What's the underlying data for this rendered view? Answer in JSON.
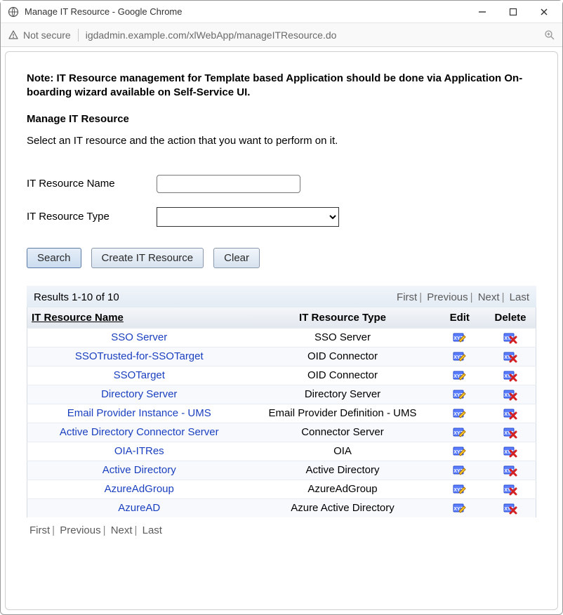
{
  "window": {
    "title": "Manage IT Resource - Google Chrome",
    "security_label": "Not secure",
    "url": "igdadmin.example.com/xlWebApp/manageITResource.do"
  },
  "note": "Note: IT Resource management for Template based Application should be done via Application On-boarding wizard available on Self-Service UI.",
  "heading": "Manage IT Resource",
  "instruction": "Select an IT resource and the action that you want to perform on it.",
  "form": {
    "name_label": "IT Resource Name",
    "type_label": "IT Resource Type",
    "name_value": "",
    "type_value": ""
  },
  "buttons": {
    "search": "Search",
    "create": "Create IT Resource",
    "clear": "Clear"
  },
  "results_label": "Results 1-10 of 10",
  "pager": {
    "first": "First",
    "previous": "Previous",
    "next": "Next",
    "last": "Last"
  },
  "columns": {
    "name": "IT Resource Name ",
    "type": "IT Resource Type",
    "edit": "Edit",
    "delete": "Delete"
  },
  "rows": [
    {
      "name": "SSO Server",
      "type": "SSO Server"
    },
    {
      "name": "SSOTrusted-for-SSOTarget",
      "type": "OID Connector"
    },
    {
      "name": "SSOTarget",
      "type": "OID Connector"
    },
    {
      "name": "Directory Server",
      "type": "Directory Server"
    },
    {
      "name": "Email Provider Instance - UMS",
      "type": "Email Provider Definition - UMS"
    },
    {
      "name": "Active Directory Connector Server",
      "type": "Connector Server"
    },
    {
      "name": "OIA-ITRes",
      "type": "OIA"
    },
    {
      "name": "Active Directory",
      "type": "Active Directory"
    },
    {
      "name": "AzureAdGroup",
      "type": "AzureAdGroup"
    },
    {
      "name": "AzureAD",
      "type": "Azure Active Directory"
    }
  ]
}
